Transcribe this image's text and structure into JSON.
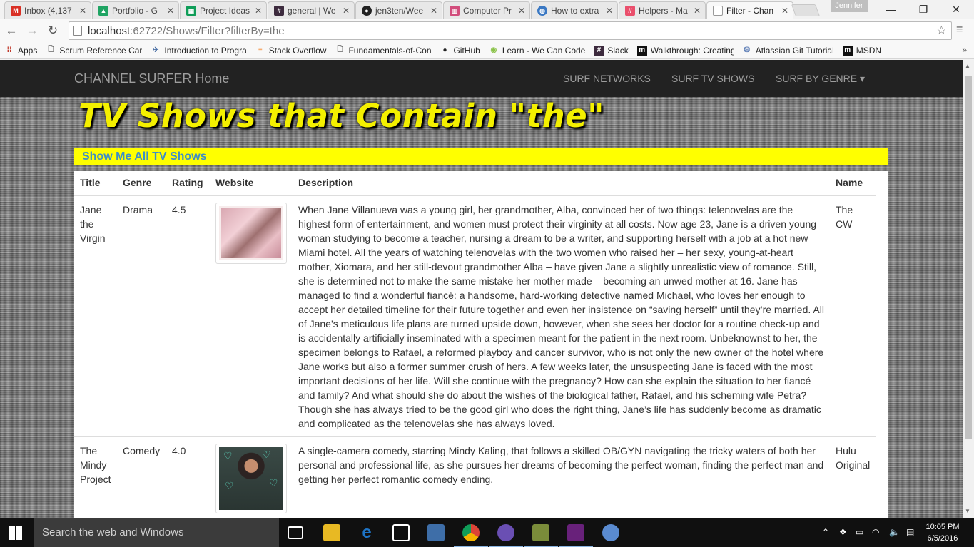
{
  "browser": {
    "tabs": [
      {
        "title": "Inbox (4,137",
        "icon": "gmail-icon",
        "color": "#d93025"
      },
      {
        "title": "Portfolio - G",
        "icon": "drive-icon",
        "color": "#1fa463"
      },
      {
        "title": "Project Ideas",
        "icon": "sheets-icon",
        "color": "#0f9d58"
      },
      {
        "title": "general | We",
        "icon": "slack-hash-icon",
        "color": "#3d2b3e"
      },
      {
        "title": "jen3ten/Wee",
        "icon": "github-icon",
        "color": "#222222"
      },
      {
        "title": "Computer Pr",
        "icon": "trello-icon",
        "color": "#d24d7c"
      },
      {
        "title": "How to extra",
        "icon": "globe-icon",
        "color": "#3a78c3"
      },
      {
        "title": "Helpers - Ma",
        "icon": "heroku-icon",
        "color": "#ea4f6c"
      },
      {
        "title": "Filter - Chan",
        "icon": "page-icon",
        "color": "#888888",
        "active": true
      }
    ],
    "profile_name": "Jennifer",
    "window_controls": {
      "minimize": "—",
      "restore": "❐",
      "close": "✕"
    },
    "url_host": "localhost",
    "url_rest": ":62722/Shows/Filter?filterBy=the",
    "bookmarks": [
      {
        "label": "Apps",
        "icon": "apps-grid-icon",
        "color": "#c0392b"
      },
      {
        "label": "Scrum Reference Card",
        "icon": "page-icon",
        "color": "#666666"
      },
      {
        "label": "Introduction to Progra",
        "icon": "plane-icon",
        "color": "#4a6fa5"
      },
      {
        "label": "Stack Overflow",
        "icon": "stackoverflow-icon",
        "color": "#f48024"
      },
      {
        "label": "Fundamentals-of-Con",
        "icon": "page-icon",
        "color": "#666666"
      },
      {
        "label": "GitHub",
        "icon": "github-icon",
        "color": "#222222"
      },
      {
        "label": "Learn - We Can Code",
        "icon": "wecancode-icon",
        "color": "#8bc34a"
      },
      {
        "label": "Slack",
        "icon": "slack-hash-icon",
        "color": "#3d2b3e"
      },
      {
        "label": "Walkthrough: Creating",
        "icon": "msdn-icon",
        "color": "#111111"
      },
      {
        "label": "Atlassian Git Tutorial",
        "icon": "database-icon",
        "color": "#5a7bb5"
      },
      {
        "label": "MSDN",
        "icon": "msdn-icon",
        "color": "#111111"
      }
    ],
    "bookmarks_more": "»"
  },
  "site": {
    "brand": "CHANNEL SURFER Home",
    "nav": [
      {
        "label": "SURF NETWORKS"
      },
      {
        "label": "SURF TV SHOWS"
      },
      {
        "label": "SURF BY GENRE ▾"
      }
    ],
    "page_title": "TV Shows that Contain \"the\"",
    "show_all_link": "Show Me All TV Shows",
    "table": {
      "headers": [
        "Title",
        "Genre",
        "Rating",
        "Website",
        "Description",
        "Name"
      ],
      "rows": [
        {
          "title": "Jane the Virgin",
          "genre": "Drama",
          "rating": "4.5",
          "website_image": "jane-the-virgin-poster",
          "description": "When Jane Villanueva was a young girl, her grandmother, Alba, convinced her of two things: telenovelas are the highest form of entertainment, and women must protect their virginity at all costs. Now age 23, Jane is a driven young woman studying to become a teacher, nursing a dream to be a writer, and supporting herself with a job at a hot new Miami hotel. All the years of watching telenovelas with the two women who raised her – her sexy, young-at-heart mother, Xiomara, and her still-devout grandmother Alba – have given Jane a slightly unrealistic view of romance. Still, she is determined not to make the same mistake her mother made – becoming an unwed mother at 16. Jane has managed to find a wonderful fiancé: a handsome, hard-working detective named Michael, who loves her enough to accept her detailed timeline for their future together and even her insistence on “saving herself” until they’re married. All of Jane’s meticulous life plans are turned upside down, however, when she sees her doctor for a routine check-up and is accidentally artificially inseminated with a specimen meant for the patient in the next room. Unbeknownst to her, the specimen belongs to Rafael, a reformed playboy and cancer survivor, who is not only the new owner of the hotel where Jane works but also a former summer crush of hers. A few weeks later, the unsuspecting Jane is faced with the most important decisions of her life. Will she continue with the pregnancy? How can she explain the situation to her fiancé and family? And what should she do about the wishes of the biological father, Rafael, and his scheming wife Petra? Though she has always tried to be the good girl who does the right thing, Jane’s life has suddenly become as dramatic and complicated as the telenovelas she has always loved.",
          "network": "The CW"
        },
        {
          "title": "The Mindy Project",
          "genre": "Comedy",
          "rating": "4.0",
          "website_image": "mindy-project-poster",
          "description": "A single-camera comedy, starring Mindy Kaling, that follows a skilled OB/GYN navigating the tricky waters of both her personal and professional life, as she pursues her dreams of becoming the perfect woman, finding the perfect man and getting her perfect romantic comedy ending.",
          "network": "Hulu Original"
        }
      ]
    }
  },
  "taskbar": {
    "search_placeholder": "Search the web and Windows",
    "apps": [
      {
        "icon": "task-view-icon",
        "color": "#101010",
        "label": "▭"
      },
      {
        "icon": "file-explorer-icon",
        "color": "#e8b923",
        "label": ""
      },
      {
        "icon": "edge-icon",
        "color": "#1e74c6",
        "label": "e"
      },
      {
        "icon": "store-icon",
        "color": "#444444",
        "label": "🛍"
      },
      {
        "icon": "network-app-icon",
        "color": "#3e6ea8",
        "label": ""
      },
      {
        "icon": "chrome-icon",
        "color": "#db4437",
        "label": "",
        "running": true
      },
      {
        "icon": "app-purple-icon",
        "color": "#6a4fb3",
        "label": ""
      },
      {
        "icon": "tools-icon",
        "color": "#7a8c3a",
        "label": ""
      },
      {
        "icon": "visual-studio-icon",
        "color": "#68217a",
        "label": ""
      },
      {
        "icon": "paint-icon",
        "color": "#5a8bd0",
        "label": ""
      }
    ],
    "tray_icons": [
      "chevron-up-icon",
      "dropbox-icon",
      "battery-icon",
      "wifi-icon",
      "volume-icon",
      "notifications-icon"
    ],
    "time": "10:05 PM",
    "date": "6/5/2016"
  }
}
